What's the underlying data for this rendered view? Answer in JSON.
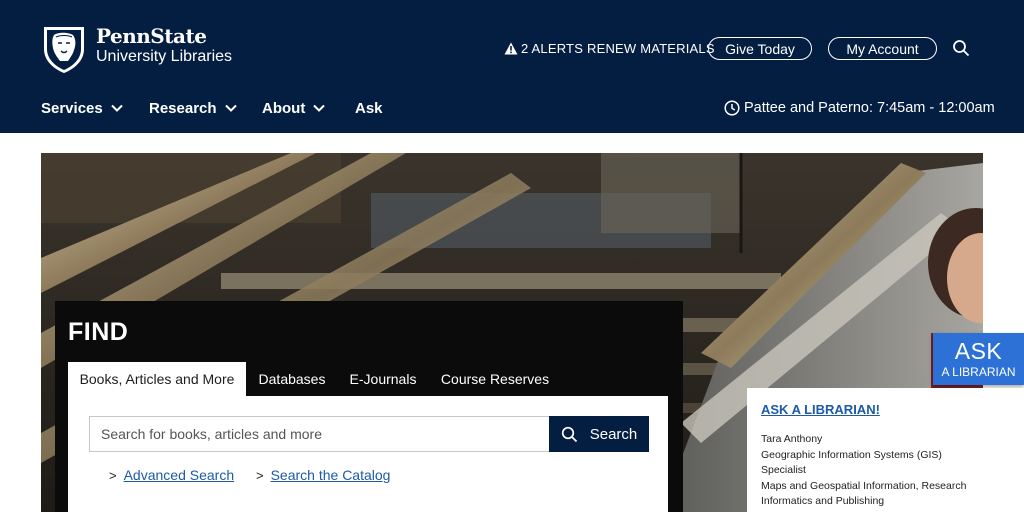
{
  "header": {
    "logo": {
      "line1": "PennState",
      "line2": "University Libraries"
    },
    "alerts_label": "2 ALERTS",
    "renew_label": "RENEW MATERIALS",
    "give_label": "Give Today",
    "account_label": "My Account",
    "nav": [
      {
        "label": "Services"
      },
      {
        "label": "Research"
      },
      {
        "label": "About"
      },
      {
        "label": "Ask"
      }
    ],
    "hours": "Pattee and Paterno: 7:45am - 12:00am"
  },
  "colors": {
    "navy": "#041e42",
    "ask_blue": "#2e71d6",
    "link_blue": "#1c5aa8"
  },
  "find": {
    "title": "FIND",
    "tabs": [
      {
        "label": "Books, Articles and More",
        "active": true
      },
      {
        "label": "Databases"
      },
      {
        "label": "E-Journals"
      },
      {
        "label": "Course Reserves"
      }
    ],
    "search_placeholder": "Search for books, articles and more",
    "search_button": "Search",
    "links": [
      {
        "prefix": ">",
        "label": "Advanced Search"
      },
      {
        "prefix": ">",
        "label": "Search the Catalog"
      }
    ]
  },
  "ask": {
    "tab_big": "ASK",
    "tab_small": "A LIBRARIAN",
    "card_title": "ASK A LIBRARIAN!",
    "name": "Tara Anthony",
    "lines": [
      "Geographic Information Systems (GIS)",
      "Specialist",
      "Maps and Geospatial Information, Research",
      "Informatics and Publishing"
    ]
  }
}
